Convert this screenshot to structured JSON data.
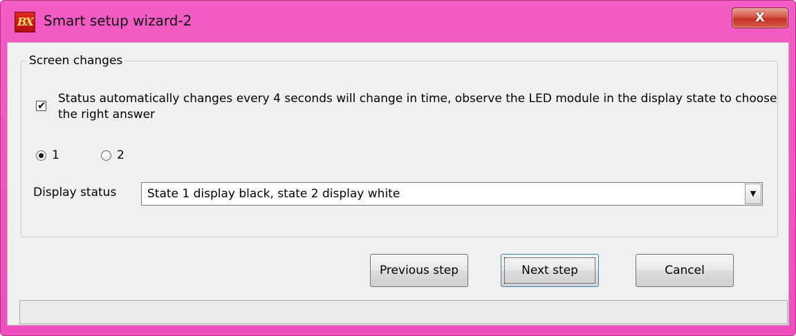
{
  "window": {
    "app_logo_text": "BX",
    "title": "Smart setup wizard-2",
    "close_glyph": "X",
    "colors": {
      "frame": "#ef4fbf",
      "close_button": "#c43325",
      "client": "#f0f0f0"
    }
  },
  "group": {
    "legend": "Screen changes",
    "checkbox": {
      "checked": true,
      "label": "Status automatically changes every 4 seconds will change in time, observe the LED module in the display state to choose the right answer"
    },
    "radios": [
      {
        "label": "1",
        "selected": true
      },
      {
        "label": "2",
        "selected": false
      }
    ],
    "display_status": {
      "label": "Display status",
      "value": "State 1 display black, state 2 display white",
      "arrow_icon": "chevron-down-icon"
    }
  },
  "buttons": {
    "previous": "Previous step",
    "next": "Next step",
    "cancel": "Cancel"
  },
  "statusbar": {
    "text": ""
  }
}
